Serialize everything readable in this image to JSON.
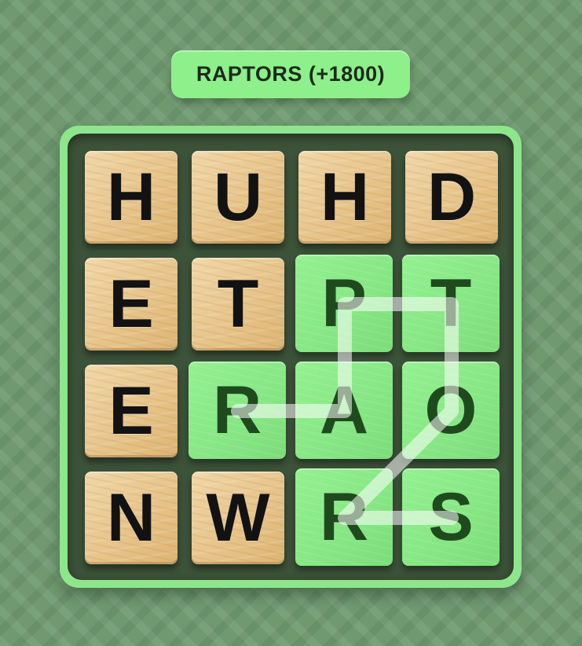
{
  "found_word": {
    "label": "RAPTORS (+1800)"
  },
  "board": {
    "rows": [
      [
        {
          "letter": "H",
          "selected": false
        },
        {
          "letter": "U",
          "selected": false
        },
        {
          "letter": "H",
          "selected": false
        },
        {
          "letter": "D",
          "selected": false
        }
      ],
      [
        {
          "letter": "E",
          "selected": false
        },
        {
          "letter": "T",
          "selected": false
        },
        {
          "letter": "P",
          "selected": true
        },
        {
          "letter": "T",
          "selected": true
        }
      ],
      [
        {
          "letter": "E",
          "selected": false
        },
        {
          "letter": "R",
          "selected": true
        },
        {
          "letter": "A",
          "selected": true
        },
        {
          "letter": "O",
          "selected": true
        }
      ],
      [
        {
          "letter": "N",
          "selected": false
        },
        {
          "letter": "W",
          "selected": false
        },
        {
          "letter": "R",
          "selected": true
        },
        {
          "letter": "S",
          "selected": true
        }
      ]
    ],
    "selection_path": [
      [
        2,
        1
      ],
      [
        2,
        2
      ],
      [
        1,
        2
      ],
      [
        1,
        3
      ],
      [
        2,
        3
      ],
      [
        3,
        2
      ],
      [
        3,
        3
      ]
    ]
  },
  "colors": {
    "background": "#6f9a70",
    "badge": "#8df08a",
    "frame": "#8de68b",
    "board_inner": "#3c5239",
    "selected_tile": "#86e683",
    "selected_letter": "#1f4a1e",
    "wood_tile": "#e7c48a",
    "letter": "#121212",
    "trace": "#ffffff"
  }
}
